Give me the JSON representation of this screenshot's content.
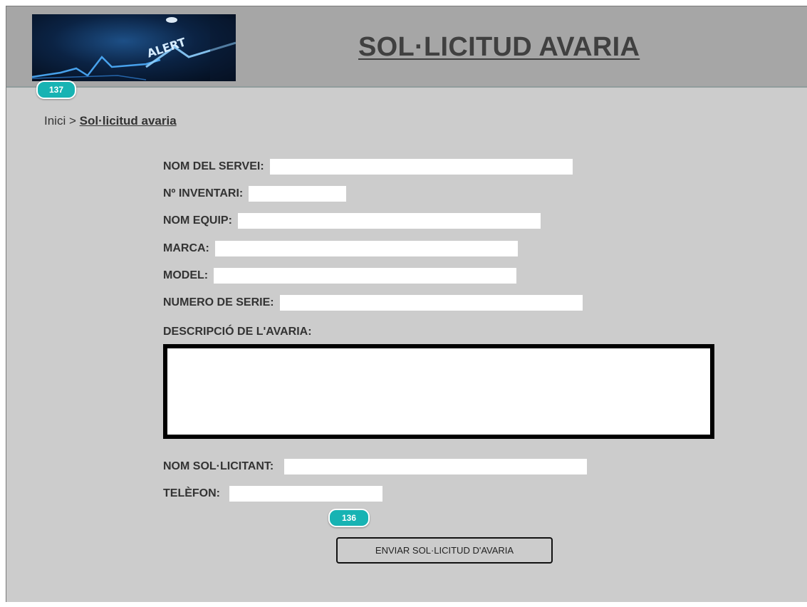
{
  "header": {
    "title": "SOL·LICITUD AVARIA",
    "logo_text": "ALERT",
    "logo_badge": "137"
  },
  "breadcrumb": {
    "home": "Inici",
    "separator": ">",
    "current": "Sol·licitud avaria"
  },
  "form": {
    "fields": [
      {
        "label": "NOM DEL SERVEI:",
        "value": ""
      },
      {
        "label": "Nº INVENTARI:",
        "value": ""
      },
      {
        "label": "NOM EQUIP:",
        "value": ""
      },
      {
        "label": "MARCA:",
        "value": ""
      },
      {
        "label": "MODEL:",
        "value": ""
      },
      {
        "label": "NUMERO DE SERIE:",
        "value": ""
      },
      {
        "label": "DESCRIPCIÓ DE L'AVARIA:",
        "value": ""
      },
      {
        "label": "NOM SOL·LICITANT:",
        "value": ""
      },
      {
        "label": "TELÈFON:",
        "value": ""
      }
    ],
    "submit_badge": "136",
    "submit_label": "ENVIAR SOL·LICITUD D'AVARIA"
  },
  "colors": {
    "background": "#cccccc",
    "header": "#a6a6a6",
    "badge": "#17b3b3",
    "title_text": "#404040"
  },
  "icons": {
    "logo": "heartbeat-alert-image"
  }
}
